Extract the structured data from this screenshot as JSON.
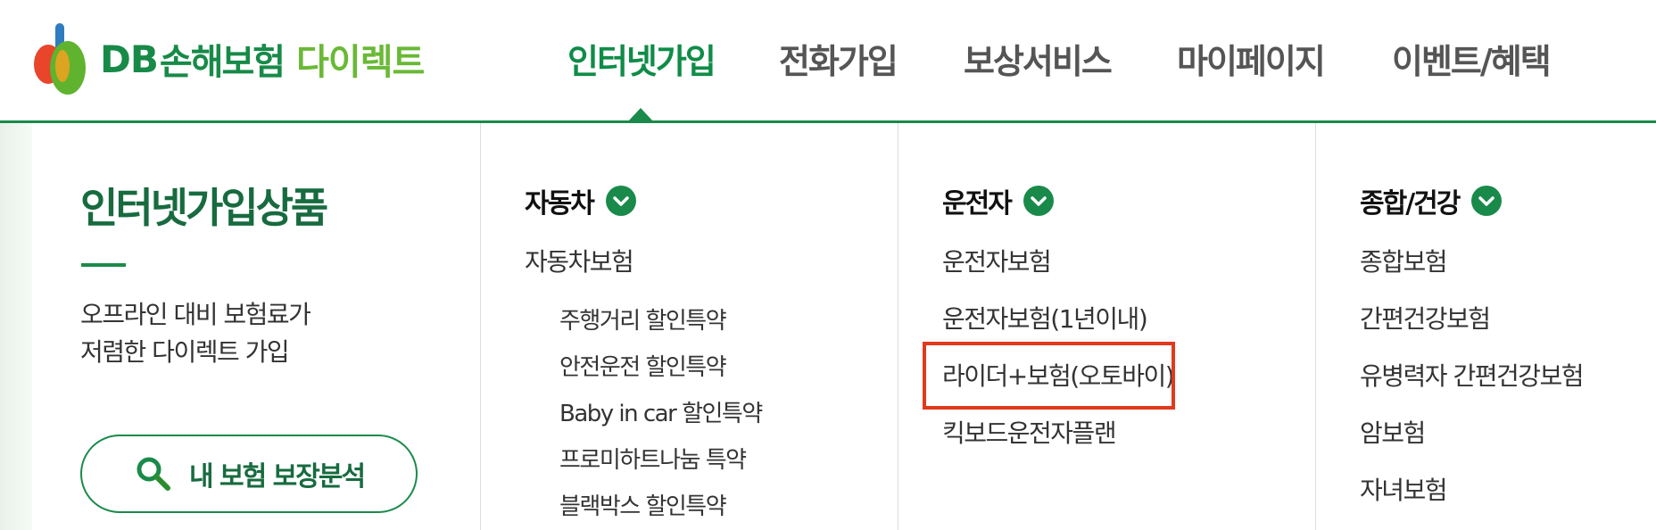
{
  "logo": {
    "db": "DB",
    "brand": "손해보험",
    "direct": "다이렉트"
  },
  "gnb": {
    "items": [
      {
        "label": "인터넷가입",
        "active": true
      },
      {
        "label": "전화가입",
        "active": false
      },
      {
        "label": "보상서비스",
        "active": false
      },
      {
        "label": "마이페이지",
        "active": false
      },
      {
        "label": "이벤트/혜택",
        "active": false
      }
    ]
  },
  "intro": {
    "title": "인터넷가입상품",
    "desc_line1": "오프라인 대비 보험료가",
    "desc_line2": "저렴한 다이렉트 가입",
    "button_label": "내 보험 보장분석"
  },
  "columns": {
    "car": {
      "heading": "자동차",
      "items": [
        "자동차보험"
      ],
      "sub_items": [
        "주행거리 할인특약",
        "안전운전 할인특약",
        "Baby in car 할인특약",
        "프로미하트나눔 특약",
        "블랙박스 할인특약"
      ]
    },
    "driver": {
      "heading": "운전자",
      "items": [
        "운전자보험",
        "운전자보험(1년이내)",
        "라이더+보험(오토바이)",
        "킥보드운전자플랜"
      ]
    },
    "health": {
      "heading": "종합/건강",
      "items": [
        "종합보험",
        "간편건강보험",
        "유병력자 간편건강보험",
        "암보험",
        "자녀보험"
      ]
    }
  },
  "colors": {
    "brand_green": "#1a8a4a",
    "active_nav": "#0f8c48",
    "highlight": "#e2391c"
  }
}
